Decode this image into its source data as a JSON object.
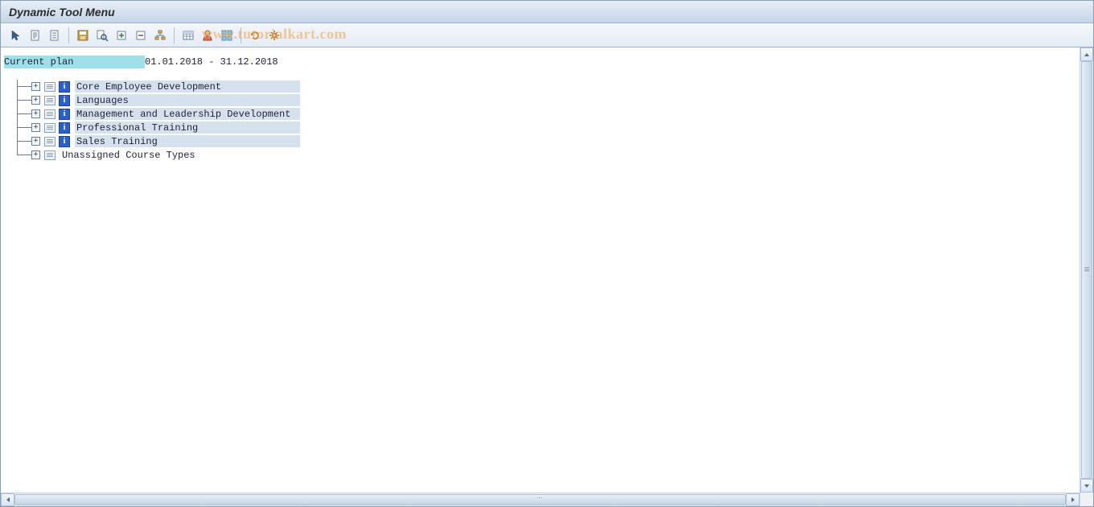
{
  "title": "Dynamic Tool Menu",
  "watermark": "www.tutorialkart.com",
  "plan": {
    "label": "Current plan",
    "date_range": "01.01.2018 - 31.12.2018"
  },
  "tree": {
    "items": [
      {
        "label": "Core Employee Development",
        "info": true
      },
      {
        "label": "Languages",
        "info": true
      },
      {
        "label": "Management and Leadership Development",
        "info": true
      },
      {
        "label": "Professional Training",
        "info": true
      },
      {
        "label": "Sales Training",
        "info": true
      },
      {
        "label": "Unassigned Course Types",
        "info": false
      }
    ]
  },
  "toolbar_icons": [
    "select-arrow",
    "document-1",
    "document-2",
    "sep",
    "save",
    "search-doc",
    "expand-all",
    "collapse-all",
    "hierarchy",
    "sep",
    "table-view",
    "user",
    "grid",
    "sep",
    "refresh",
    "settings"
  ]
}
